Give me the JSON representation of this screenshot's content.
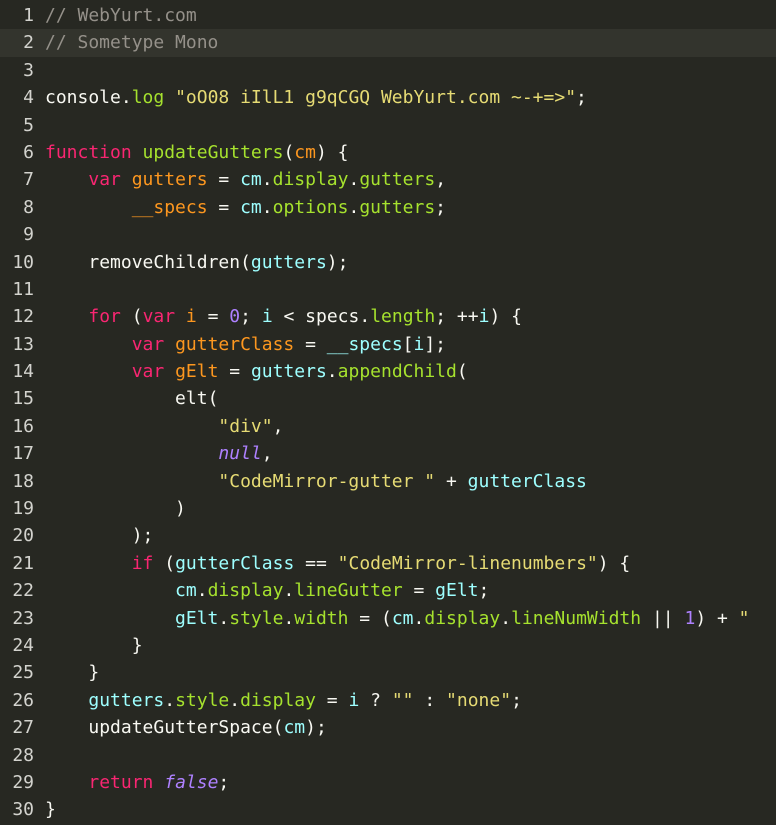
{
  "editor": {
    "lines": [
      {
        "num": "1",
        "tokens": [
          {
            "t": "// WebYurt.com",
            "c": "comment"
          }
        ]
      },
      {
        "num": "2",
        "active": true,
        "tokens": [
          {
            "t": "// Sometype Mono",
            "c": "comment"
          }
        ]
      },
      {
        "num": "3",
        "tokens": []
      },
      {
        "num": "4",
        "tokens": [
          {
            "t": "console",
            "c": "plain"
          },
          {
            "t": ".",
            "c": "plain"
          },
          {
            "t": "log",
            "c": "property"
          },
          {
            "t": " ",
            "c": "plain"
          },
          {
            "t": "\"oO08 iIlL1 g9qCGQ WebYurt.com ~-+=>\"",
            "c": "string"
          },
          {
            "t": ";",
            "c": "plain"
          }
        ]
      },
      {
        "num": "5",
        "tokens": []
      },
      {
        "num": "6",
        "tokens": [
          {
            "t": "function",
            "c": "keyword"
          },
          {
            "t": " ",
            "c": "plain"
          },
          {
            "t": "updateGutters",
            "c": "variable"
          },
          {
            "t": "(",
            "c": "plain"
          },
          {
            "t": "cm",
            "c": "def"
          },
          {
            "t": ") {",
            "c": "plain"
          }
        ]
      },
      {
        "num": "7",
        "tokens": [
          {
            "t": "    ",
            "c": "plain"
          },
          {
            "t": "var",
            "c": "keyword"
          },
          {
            "t": " ",
            "c": "plain"
          },
          {
            "t": "gutters",
            "c": "def"
          },
          {
            "t": " = ",
            "c": "plain"
          },
          {
            "t": "cm",
            "c": "var2"
          },
          {
            "t": ".",
            "c": "plain"
          },
          {
            "t": "display",
            "c": "property"
          },
          {
            "t": ".",
            "c": "plain"
          },
          {
            "t": "gutters",
            "c": "property"
          },
          {
            "t": ",",
            "c": "plain"
          }
        ]
      },
      {
        "num": "8",
        "tokens": [
          {
            "t": "        ",
            "c": "plain"
          },
          {
            "t": "__specs",
            "c": "def"
          },
          {
            "t": " = ",
            "c": "plain"
          },
          {
            "t": "cm",
            "c": "var2"
          },
          {
            "t": ".",
            "c": "plain"
          },
          {
            "t": "options",
            "c": "property"
          },
          {
            "t": ".",
            "c": "plain"
          },
          {
            "t": "gutters",
            "c": "property"
          },
          {
            "t": ";",
            "c": "plain"
          }
        ]
      },
      {
        "num": "9",
        "tokens": []
      },
      {
        "num": "10",
        "tokens": [
          {
            "t": "    ",
            "c": "plain"
          },
          {
            "t": "removeChildren",
            "c": "plain"
          },
          {
            "t": "(",
            "c": "plain"
          },
          {
            "t": "gutters",
            "c": "var2"
          },
          {
            "t": ");",
            "c": "plain"
          }
        ]
      },
      {
        "num": "11",
        "tokens": []
      },
      {
        "num": "12",
        "tokens": [
          {
            "t": "    ",
            "c": "plain"
          },
          {
            "t": "for",
            "c": "keyword"
          },
          {
            "t": " (",
            "c": "plain"
          },
          {
            "t": "var",
            "c": "keyword"
          },
          {
            "t": " ",
            "c": "plain"
          },
          {
            "t": "i",
            "c": "def"
          },
          {
            "t": " = ",
            "c": "plain"
          },
          {
            "t": "0",
            "c": "number"
          },
          {
            "t": "; ",
            "c": "plain"
          },
          {
            "t": "i",
            "c": "var2"
          },
          {
            "t": " < ",
            "c": "plain"
          },
          {
            "t": "specs",
            "c": "plain"
          },
          {
            "t": ".",
            "c": "plain"
          },
          {
            "t": "length",
            "c": "property"
          },
          {
            "t": "; ++",
            "c": "plain"
          },
          {
            "t": "i",
            "c": "var2"
          },
          {
            "t": ") {",
            "c": "plain"
          }
        ]
      },
      {
        "num": "13",
        "tokens": [
          {
            "t": "        ",
            "c": "plain"
          },
          {
            "t": "var",
            "c": "keyword"
          },
          {
            "t": " ",
            "c": "plain"
          },
          {
            "t": "gutterClass",
            "c": "def"
          },
          {
            "t": " = ",
            "c": "plain"
          },
          {
            "t": "__specs",
            "c": "var2"
          },
          {
            "t": "[",
            "c": "plain"
          },
          {
            "t": "i",
            "c": "var2"
          },
          {
            "t": "];",
            "c": "plain"
          }
        ]
      },
      {
        "num": "14",
        "tokens": [
          {
            "t": "        ",
            "c": "plain"
          },
          {
            "t": "var",
            "c": "keyword"
          },
          {
            "t": " ",
            "c": "plain"
          },
          {
            "t": "gElt",
            "c": "def"
          },
          {
            "t": " = ",
            "c": "plain"
          },
          {
            "t": "gutters",
            "c": "var2"
          },
          {
            "t": ".",
            "c": "plain"
          },
          {
            "t": "appendChild",
            "c": "property"
          },
          {
            "t": "(",
            "c": "plain"
          }
        ]
      },
      {
        "num": "15",
        "tokens": [
          {
            "t": "            ",
            "c": "plain"
          },
          {
            "t": "elt",
            "c": "plain"
          },
          {
            "t": "(",
            "c": "plain"
          }
        ]
      },
      {
        "num": "16",
        "tokens": [
          {
            "t": "                ",
            "c": "plain"
          },
          {
            "t": "\"div\"",
            "c": "string"
          },
          {
            "t": ",",
            "c": "plain"
          }
        ]
      },
      {
        "num": "17",
        "tokens": [
          {
            "t": "                ",
            "c": "plain"
          },
          {
            "t": "null",
            "c": "atom"
          },
          {
            "t": ",",
            "c": "plain"
          }
        ]
      },
      {
        "num": "18",
        "tokens": [
          {
            "t": "                ",
            "c": "plain"
          },
          {
            "t": "\"CodeMirror-gutter \"",
            "c": "string"
          },
          {
            "t": " + ",
            "c": "plain"
          },
          {
            "t": "gutterClass",
            "c": "var2"
          }
        ]
      },
      {
        "num": "19",
        "tokens": [
          {
            "t": "            ",
            "c": "plain"
          },
          {
            "t": ")",
            "c": "plain"
          }
        ]
      },
      {
        "num": "20",
        "tokens": [
          {
            "t": "        ",
            "c": "plain"
          },
          {
            "t": ");",
            "c": "plain"
          }
        ]
      },
      {
        "num": "21",
        "tokens": [
          {
            "t": "        ",
            "c": "plain"
          },
          {
            "t": "if",
            "c": "keyword"
          },
          {
            "t": " (",
            "c": "plain"
          },
          {
            "t": "gutterClass",
            "c": "var2"
          },
          {
            "t": " == ",
            "c": "plain"
          },
          {
            "t": "\"CodeMirror-linenumbers\"",
            "c": "string"
          },
          {
            "t": ") {",
            "c": "plain"
          }
        ]
      },
      {
        "num": "22",
        "tokens": [
          {
            "t": "            ",
            "c": "plain"
          },
          {
            "t": "cm",
            "c": "var2"
          },
          {
            "t": ".",
            "c": "plain"
          },
          {
            "t": "display",
            "c": "property"
          },
          {
            "t": ".",
            "c": "plain"
          },
          {
            "t": "lineGutter",
            "c": "property"
          },
          {
            "t": " = ",
            "c": "plain"
          },
          {
            "t": "gElt",
            "c": "var2"
          },
          {
            "t": ";",
            "c": "plain"
          }
        ]
      },
      {
        "num": "23",
        "tokens": [
          {
            "t": "            ",
            "c": "plain"
          },
          {
            "t": "gElt",
            "c": "var2"
          },
          {
            "t": ".",
            "c": "plain"
          },
          {
            "t": "style",
            "c": "property"
          },
          {
            "t": ".",
            "c": "plain"
          },
          {
            "t": "width",
            "c": "property"
          },
          {
            "t": " = (",
            "c": "plain"
          },
          {
            "t": "cm",
            "c": "var2"
          },
          {
            "t": ".",
            "c": "plain"
          },
          {
            "t": "display",
            "c": "property"
          },
          {
            "t": ".",
            "c": "plain"
          },
          {
            "t": "lineNumWidth",
            "c": "property"
          },
          {
            "t": " || ",
            "c": "plain"
          },
          {
            "t": "1",
            "c": "number"
          },
          {
            "t": ") + ",
            "c": "plain"
          },
          {
            "t": "\"",
            "c": "string"
          }
        ]
      },
      {
        "num": "24",
        "tokens": [
          {
            "t": "        ",
            "c": "plain"
          },
          {
            "t": "}",
            "c": "plain"
          }
        ]
      },
      {
        "num": "25",
        "tokens": [
          {
            "t": "    ",
            "c": "plain"
          },
          {
            "t": "}",
            "c": "plain"
          }
        ]
      },
      {
        "num": "26",
        "tokens": [
          {
            "t": "    ",
            "c": "plain"
          },
          {
            "t": "gutters",
            "c": "var2"
          },
          {
            "t": ".",
            "c": "plain"
          },
          {
            "t": "style",
            "c": "property"
          },
          {
            "t": ".",
            "c": "plain"
          },
          {
            "t": "display",
            "c": "property"
          },
          {
            "t": " = ",
            "c": "plain"
          },
          {
            "t": "i",
            "c": "var2"
          },
          {
            "t": " ? ",
            "c": "plain"
          },
          {
            "t": "\"\"",
            "c": "string"
          },
          {
            "t": " : ",
            "c": "plain"
          },
          {
            "t": "\"none\"",
            "c": "string"
          },
          {
            "t": ";",
            "c": "plain"
          }
        ]
      },
      {
        "num": "27",
        "tokens": [
          {
            "t": "    ",
            "c": "plain"
          },
          {
            "t": "updateGutterSpace",
            "c": "plain"
          },
          {
            "t": "(",
            "c": "plain"
          },
          {
            "t": "cm",
            "c": "var2"
          },
          {
            "t": ");",
            "c": "plain"
          }
        ]
      },
      {
        "num": "28",
        "tokens": []
      },
      {
        "num": "29",
        "tokens": [
          {
            "t": "    ",
            "c": "plain"
          },
          {
            "t": "return",
            "c": "keyword"
          },
          {
            "t": " ",
            "c": "plain"
          },
          {
            "t": "false",
            "c": "atom"
          },
          {
            "t": ";",
            "c": "plain"
          }
        ]
      },
      {
        "num": "30",
        "tokens": [
          {
            "t": "}",
            "c": "plain"
          }
        ]
      }
    ]
  }
}
